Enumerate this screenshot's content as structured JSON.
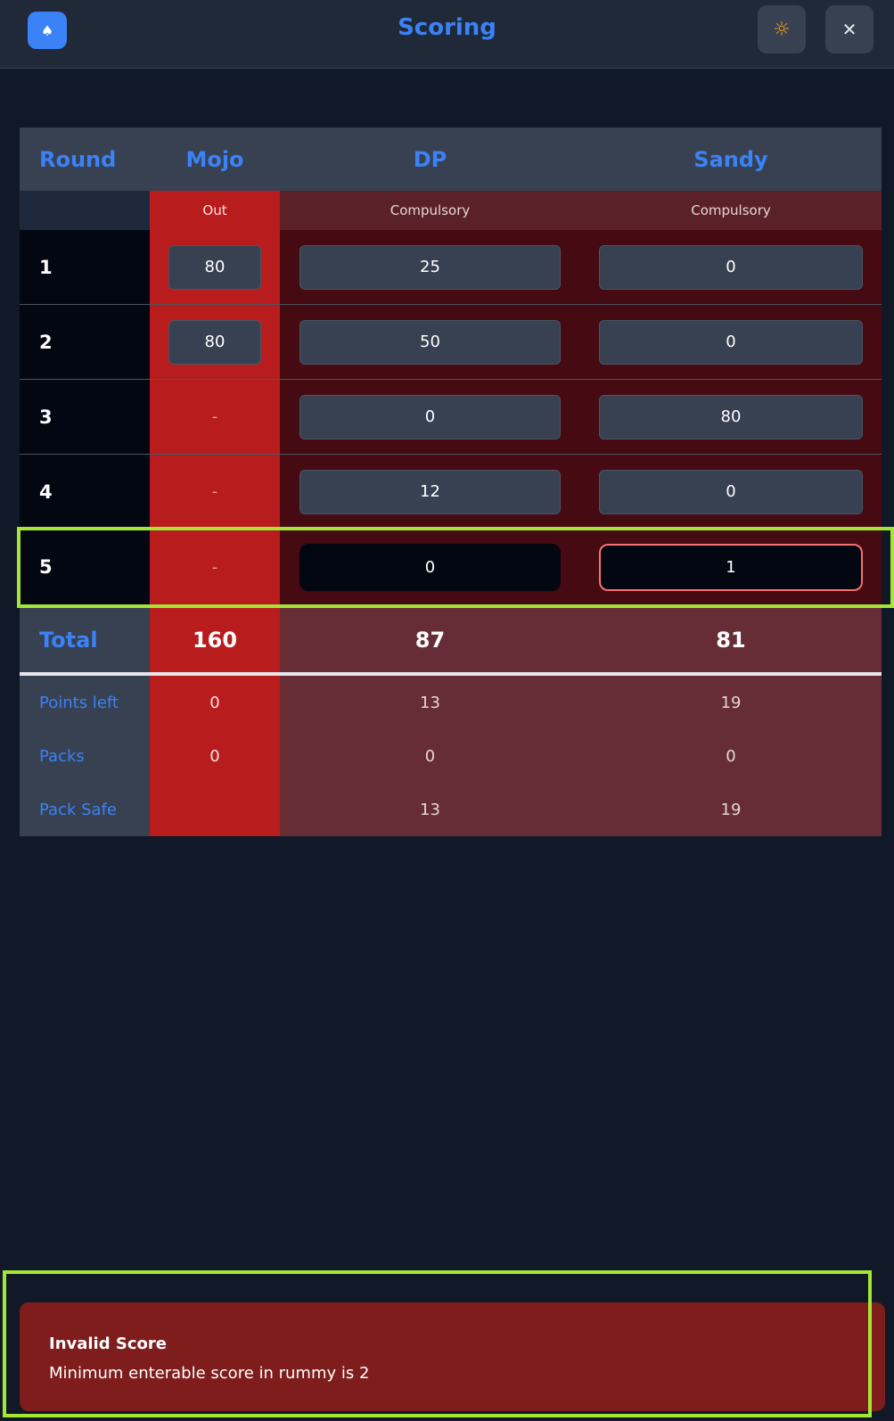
{
  "header": {
    "title": "Scoring",
    "logo_icon": "spade-icon",
    "theme_icon": "sun-icon",
    "close_icon": "close-icon"
  },
  "columns": {
    "round": "Round",
    "players": [
      "Mojo",
      "DP",
      "Sandy"
    ]
  },
  "status": [
    "Out",
    "Compulsory",
    "Compulsory"
  ],
  "rounds": [
    {
      "label": "1",
      "scores": [
        "80",
        "25",
        "0"
      ]
    },
    {
      "label": "2",
      "scores": [
        "80",
        "50",
        "0"
      ]
    },
    {
      "label": "3",
      "scores": [
        "-",
        "0",
        "80"
      ]
    },
    {
      "label": "4",
      "scores": [
        "-",
        "12",
        "0"
      ]
    },
    {
      "label": "5",
      "scores": [
        "-",
        "0",
        "1"
      ]
    }
  ],
  "total": {
    "label": "Total",
    "values": [
      "160",
      "87",
      "81"
    ]
  },
  "stats": [
    {
      "label": "Points left",
      "values": [
        "0",
        "13",
        "19"
      ]
    },
    {
      "label": "Packs",
      "values": [
        "0",
        "0",
        "0"
      ]
    },
    {
      "label": "Pack Safe",
      "values": [
        "",
        "13",
        "19"
      ]
    }
  ],
  "toast": {
    "title": "Invalid Score",
    "message": "Minimum enterable score in rummy is 2"
  },
  "colors": {
    "accent": "#3b82f6",
    "out_column": "#b91c1c",
    "compulsory_column": "#450a12",
    "error_border": "#f87171",
    "toast_bg": "#7f1d1d",
    "highlight": "#a3e635"
  }
}
